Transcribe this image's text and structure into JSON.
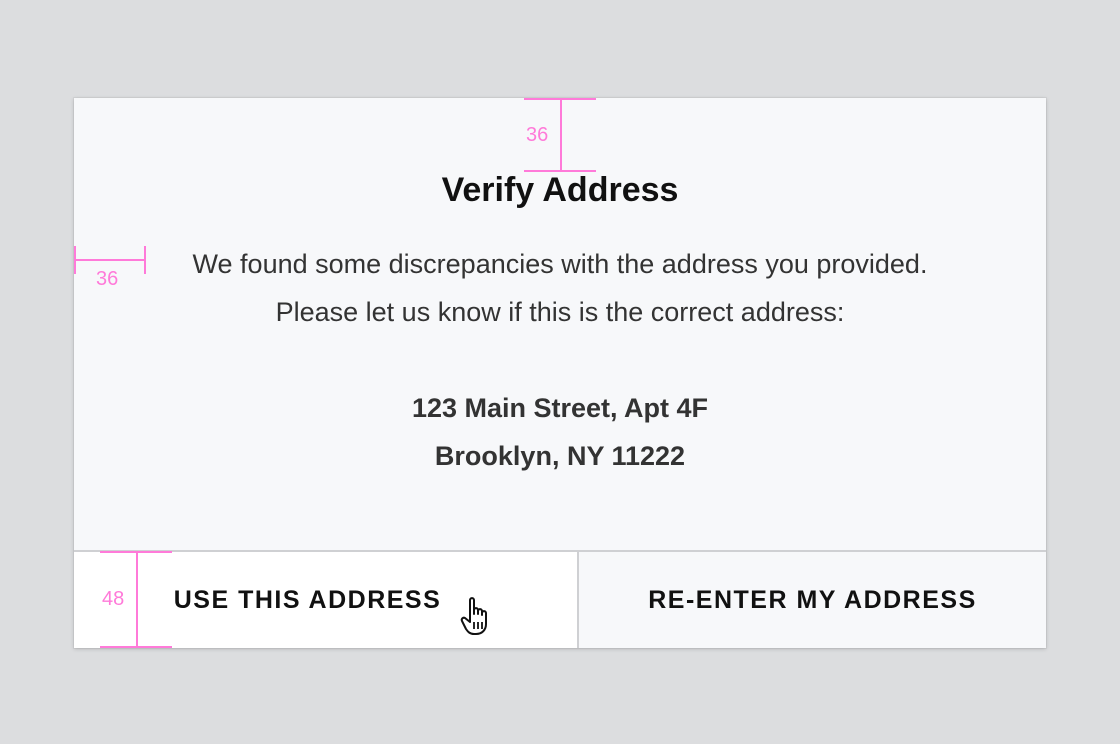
{
  "dialog": {
    "title": "Verify Address",
    "message_line1": "We found some discrepancies with the address you provided.",
    "message_line2": "Please let us know if this is the correct address:",
    "address_line1": "123 Main Street, Apt 4F",
    "address_line2": "Brooklyn, NY 11222",
    "primary_button": "USE THIS ADDRESS",
    "secondary_button": "RE-ENTER MY ADDRESS"
  },
  "annotations": {
    "top_spacing": "36",
    "side_spacing": "36",
    "button_height": "48",
    "color": "#ff7ad9"
  },
  "cursor": {
    "icon": "hand-pointer-icon"
  }
}
